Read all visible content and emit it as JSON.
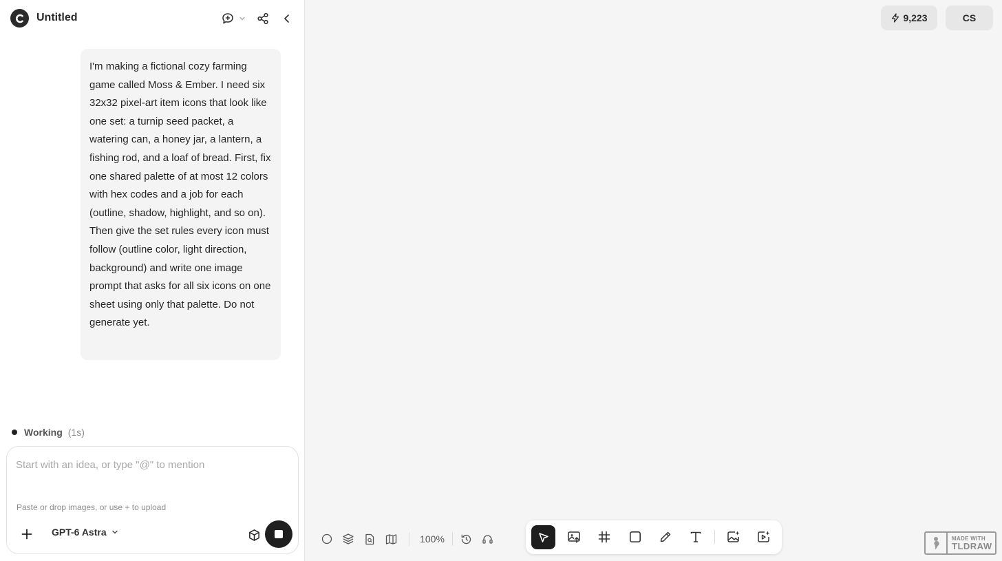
{
  "header": {
    "title": "Untitled",
    "logo_icon": "c-logo-icon",
    "icons": [
      "comment-plus-icon",
      "chevron-down-icon",
      "share-icon",
      "chevron-left-icon"
    ]
  },
  "chat": {
    "user_message": "I'm making a fictional cozy farming game called Moss & Ember. I need six 32x32 pixel-art item icons that look like one set: a turnip seed packet, a watering can, a honey jar, a lantern, a fishing rod, and a loaf of bread. First, fix one shared palette of at most 12 colors with hex codes and a job for each (outline, shadow, highlight, and so on). Then give the set rules every icon must follow (outline color, light direction, background) and write one image prompt that asks for all six icons on one sheet using only that palette. Do not generate yet."
  },
  "status": {
    "label": "Working",
    "time": "(1s)"
  },
  "composer": {
    "placeholder": "Start with an idea, or type \"@\" to mention",
    "value": "",
    "hint": "Paste or drop images, or use + to upload",
    "model": "GPT-6 Astra"
  },
  "topbar": {
    "credits": "9,223",
    "avatar_initials": "CS"
  },
  "canvas_controls": {
    "zoom": "100%",
    "icons": [
      "circle-icon",
      "layers-icon",
      "file-search-icon",
      "map-icon",
      "history-icon",
      "headset-icon"
    ]
  },
  "toolbar": {
    "active_tool": "select",
    "tools": [
      "select-arrow-icon",
      "image-upload-icon",
      "frame-hash-icon",
      "rectangle-icon",
      "pencil-icon",
      "text-icon",
      "ai-image-icon",
      "ai-video-icon"
    ]
  },
  "watermark": {
    "line1": "MADE WITH",
    "line2": "TLDRAW"
  },
  "colors": {
    "panel_bg": "#ffffff",
    "canvas_bg": "#f5f5f5",
    "bubble_bg": "#f4f4f4",
    "accent_dark": "#1e1e1e"
  }
}
